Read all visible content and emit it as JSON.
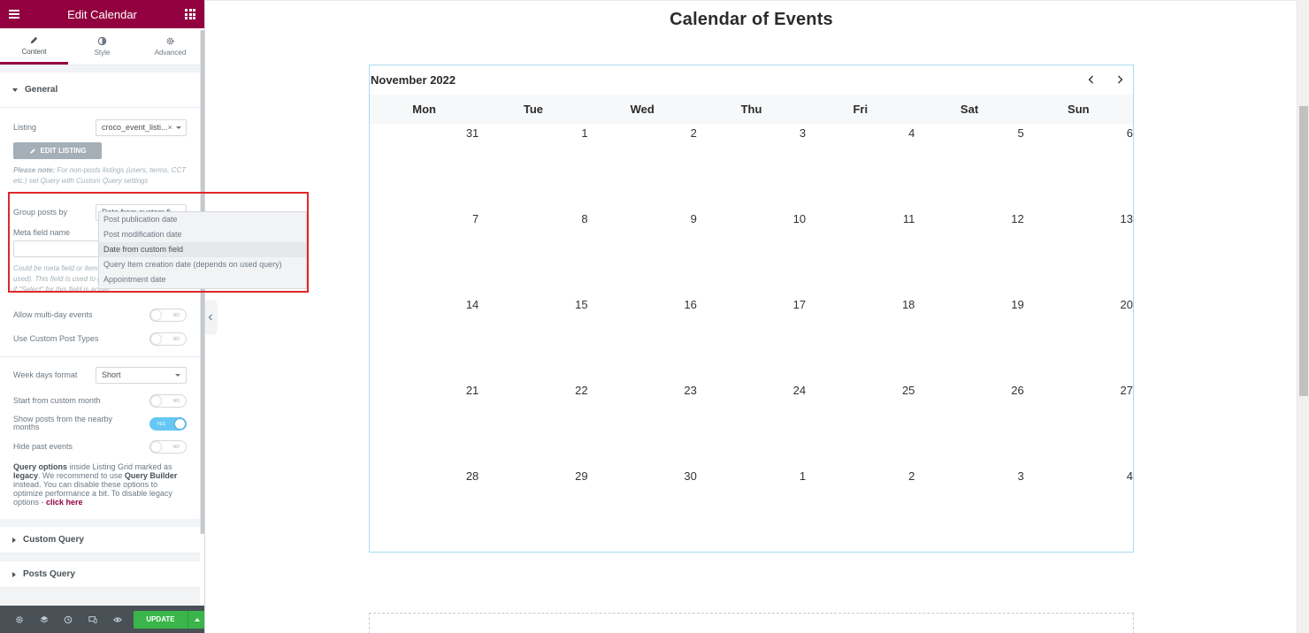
{
  "panel": {
    "title": "Edit Calendar",
    "tabs": [
      {
        "label": "Content"
      },
      {
        "label": "Style"
      },
      {
        "label": "Advanced"
      }
    ],
    "general": {
      "heading": "General",
      "listing_label": "Listing",
      "listing_value": "croco_event_listi...",
      "edit_listing_label": "EDIT LISTING",
      "note_bold": "Please note:",
      "note_text": " For non-posts listings (users, terms, CCT etc.) set Query with Custom Query settings",
      "group_posts_label": "Group posts by",
      "group_posts_value": "Date from custom fi",
      "meta_field_label": "Meta field name",
      "meta_field_value": "",
      "meta_note": "Could be meta field or item field (depends on query used). This field is used to group items by. Works only if \"Select\" for this field is active",
      "allow_multiday_label": "Allow multi-day events",
      "custom_post_types_label": "Use Custom Post Types",
      "week_days_format_label": "Week days format",
      "week_days_format_value": "Short",
      "start_custom_month_label": "Start from custom month",
      "show_nearby_label": "Show posts from the nearby months",
      "hide_past_label": "Hide past events",
      "toggle_no": "NO",
      "toggle_yes": "YES",
      "legacy_1": "Query options",
      "legacy_2": " inside Listing Grid marked as ",
      "legacy_3": "legacy",
      "legacy_4": ". We recommend to use ",
      "legacy_5": "Query Builder",
      "legacy_6": " instead. You can disable these options to optimize performance a bit. To disable legacy options - ",
      "legacy_link": "click here"
    },
    "custom_query_heading": "Custom Query",
    "posts_query_heading": "Posts Query",
    "dropdown_options": [
      "Post publication date",
      "Post modification date",
      "Date from custom field",
      "Query Item creation date (depends on used query)",
      "Appointment date"
    ],
    "dropdown_selected_index": 2,
    "footer": {
      "update_label": "UPDATE"
    }
  },
  "preview": {
    "page_title": "Calendar of Events",
    "calendar": {
      "month": "November 2022",
      "weekdays": [
        "Mon",
        "Tue",
        "Wed",
        "Thu",
        "Fri",
        "Sat",
        "Sun"
      ],
      "weeks": [
        [
          "31",
          "1",
          "2",
          "3",
          "4",
          "5",
          "6"
        ],
        [
          "7",
          "8",
          "9",
          "10",
          "11",
          "12",
          "13"
        ],
        [
          "14",
          "15",
          "16",
          "17",
          "18",
          "19",
          "20"
        ],
        [
          "21",
          "22",
          "23",
          "24",
          "25",
          "26",
          "27"
        ],
        [
          "28",
          "29",
          "30",
          "1",
          "2",
          "3",
          "4"
        ]
      ]
    }
  },
  "colors": {
    "brand": "#93003f",
    "update_green": "#39b54a",
    "toggle_on": "#66c7f4",
    "highlight_red": "#e0262c",
    "calendar_border": "#a8dcef"
  },
  "icons": {
    "menu": "hamburger-icon",
    "apps": "grid-icon",
    "content_tab": "pencil-icon",
    "style_tab": "contrast-icon",
    "advanced_tab": "gear-icon",
    "edit_listing": "pencil-icon",
    "prev": "chevron-left-icon",
    "next": "chevron-right-icon"
  }
}
